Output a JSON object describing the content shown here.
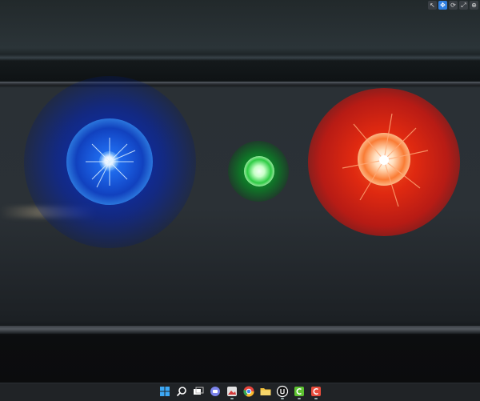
{
  "window": {
    "title": "",
    "toolbar": [
      {
        "name": "select-mode-icon",
        "glyph": "↖",
        "active": false
      },
      {
        "name": "move-mode-icon",
        "glyph": "✥",
        "active": true
      },
      {
        "name": "rotate-mode-icon",
        "glyph": "⟳",
        "active": false
      },
      {
        "name": "scale-mode-icon",
        "glyph": "⤢",
        "active": false
      },
      {
        "name": "world-space-icon",
        "glyph": "⊕",
        "active": false
      }
    ]
  },
  "scene": {
    "lights": [
      {
        "name": "blue-light",
        "color": "#1e5cff"
      },
      {
        "name": "green-light",
        "color": "#1ed234"
      },
      {
        "name": "red-light",
        "color": "#ff2a14"
      }
    ]
  },
  "taskbar": {
    "icons": [
      {
        "name": "start-windows-icon",
        "color": "#3da8f5"
      },
      {
        "name": "search-icon",
        "color": "#ffffff"
      },
      {
        "name": "task-view-icon",
        "color": "#ffffff"
      },
      {
        "name": "chat-icon",
        "color": "#7b83eb"
      },
      {
        "name": "photos-app-icon",
        "color": "#e2e2e2"
      },
      {
        "name": "chrome-browser-icon",
        "color": "#e8453c"
      },
      {
        "name": "file-explorer-icon",
        "color": "#f3c13a"
      },
      {
        "name": "unreal-engine-icon",
        "color": "#ffffff"
      },
      {
        "name": "camtasia-green-icon",
        "color": "#5cc230"
      },
      {
        "name": "camtasia-red-icon",
        "color": "#e74c3c"
      }
    ]
  }
}
